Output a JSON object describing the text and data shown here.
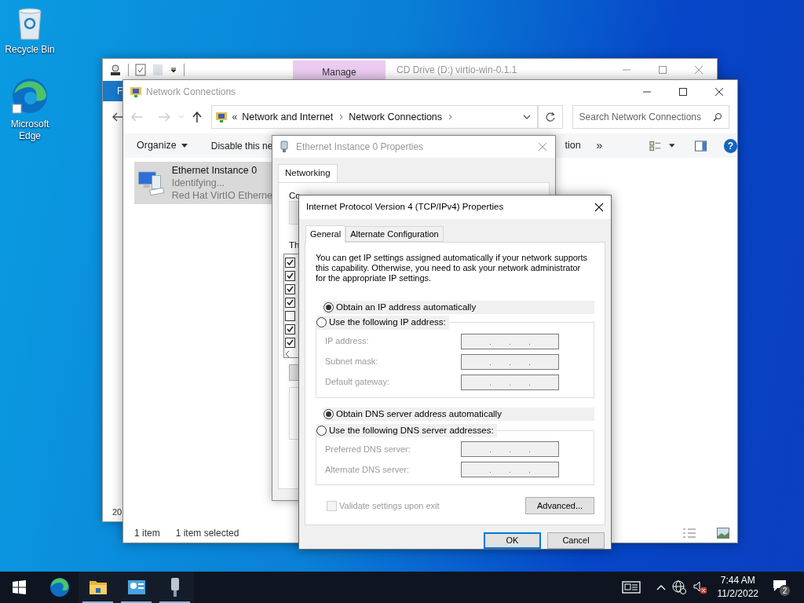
{
  "desktop_icons": [
    {
      "label": "Recycle Bin",
      "kind": "recycle"
    },
    {
      "label": "Microsoft Edge",
      "kind": "edge"
    }
  ],
  "drive_window": {
    "title": "CD Drive (D:) virtio-win-0.1.1",
    "context_tab": "Manage",
    "ribbon_tab": "F",
    "status": "20"
  },
  "explorer": {
    "title": "Network Connections",
    "breadcrumb_prefix": "«",
    "breadcrumb": [
      "Network and Internet",
      "Network Connections"
    ],
    "search_placeholder": "Search Network Connections",
    "toolbar": [
      "Organize",
      "Disable this ne"
    ],
    "toolbar_cut": "tion",
    "more": "»",
    "help": "?",
    "item": {
      "name": "Ethernet Instance 0",
      "status": "Identifying...",
      "device": "Red Hat VirtIO Etherne",
      "selected": true
    },
    "status_bar": [
      "1 item",
      "1 item selected"
    ]
  },
  "eth_props": {
    "title": "Ethernet Instance 0 Properties",
    "tab": "Networking",
    "connect_label": "Co",
    "list_label": "Th",
    "items": [
      {
        "checked": true
      },
      {
        "checked": true
      },
      {
        "checked": true
      },
      {
        "checked": true
      },
      {
        "checked": false
      },
      {
        "checked": true
      },
      {
        "checked": true
      }
    ]
  },
  "ipv4": {
    "title": "Internet Protocol Version 4 (TCP/IPv4) Properties",
    "tabs": [
      {
        "label": "General",
        "selected": true
      },
      {
        "label": "Alternate Configuration",
        "selected": false
      }
    ],
    "intro": "You can get IP settings assigned automatically if your network supports this capability. Otherwise, you need to ask your network administrator for the appropriate IP settings.",
    "ip_auto": {
      "label": "Obtain an IP address automatically",
      "selected": true
    },
    "ip_manual": {
      "label": "Use the following IP address:",
      "selected": false
    },
    "ip_fields": [
      {
        "label": "IP address:",
        "disabled": true
      },
      {
        "label": "Subnet mask:",
        "disabled": true
      },
      {
        "label": "Default gateway:",
        "disabled": true
      }
    ],
    "dns_auto": {
      "label": "Obtain DNS server address automatically",
      "selected": true
    },
    "dns_manual": {
      "label": "Use the following DNS server addresses:",
      "selected": false
    },
    "dns_fields": [
      {
        "label": "Preferred DNS server:",
        "disabled": true
      },
      {
        "label": "Alternate DNS server:",
        "disabled": true
      }
    ],
    "validate": {
      "label": "Validate settings upon exit",
      "checked": false,
      "disabled": true
    },
    "advanced": "Advanced...",
    "ok": "OK",
    "cancel": "Cancel"
  },
  "taskbar": {
    "apps": [
      {
        "kind": "edge",
        "open": false
      },
      {
        "kind": "folder",
        "open": true
      },
      {
        "kind": "control",
        "open": true
      },
      {
        "kind": "network",
        "open": true
      }
    ],
    "time": "7:44 AM",
    "date": "11/2/2022",
    "notifications": "2"
  }
}
